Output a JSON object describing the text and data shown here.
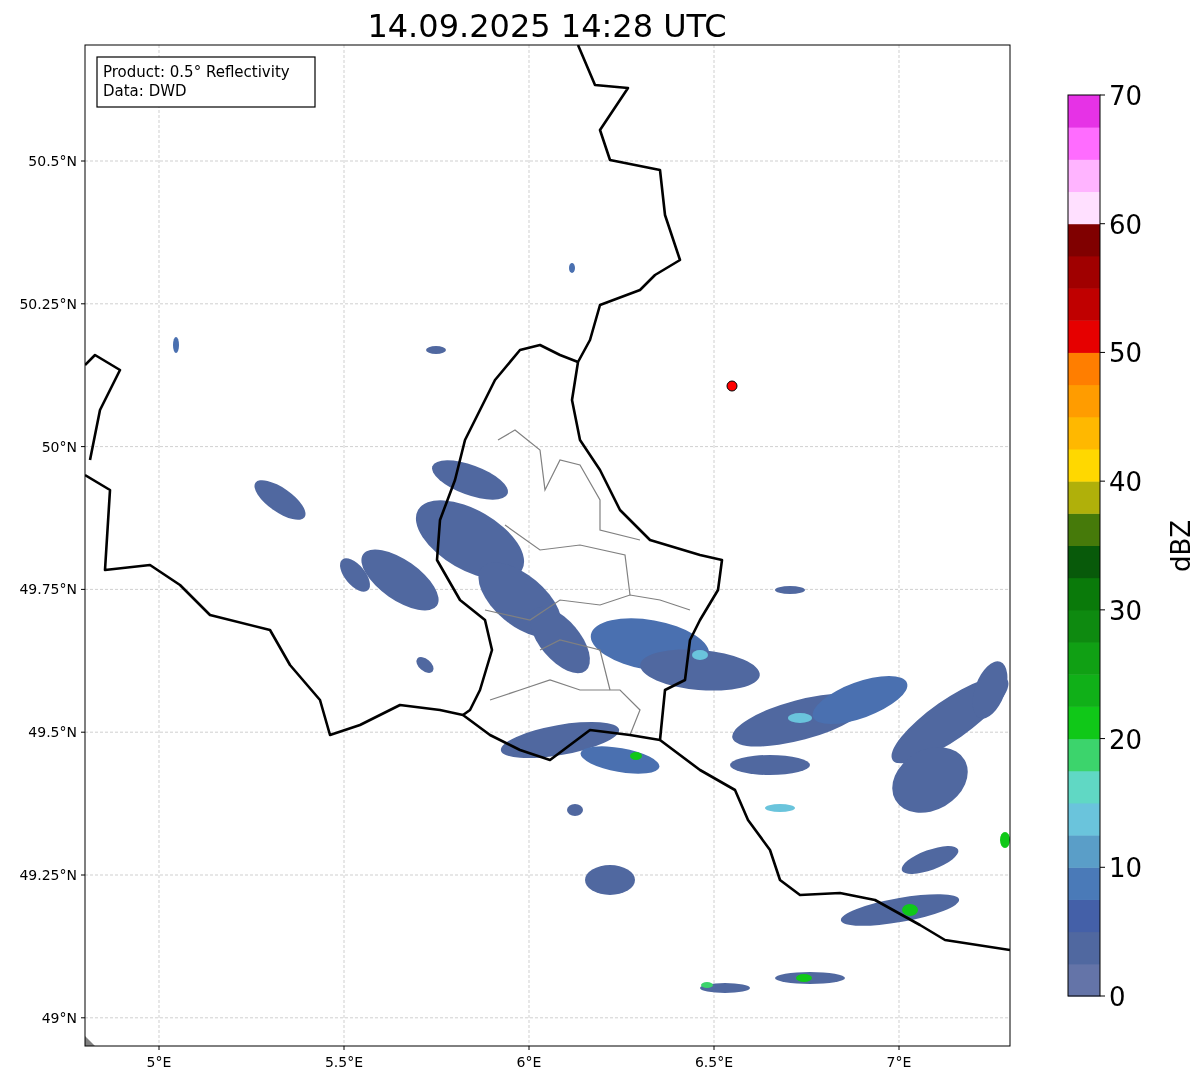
{
  "title": "14.09.2025 14:28 UTC",
  "info_box": [
    "Product: 0.5° Reflectivity",
    "Data: DWD"
  ],
  "y_ticks": [
    "50.5°N",
    "50.25°N",
    "50°N",
    "49.75°N",
    "49.5°N",
    "49.25°N",
    "49°N"
  ],
  "x_ticks": [
    "5°E",
    "5.5°E",
    "6°E",
    "6.5°E",
    "7°E"
  ],
  "colorbar": {
    "label": "dBZ",
    "ticks": [
      "70",
      "60",
      "50",
      "40",
      "30",
      "20",
      "10",
      "0"
    ],
    "bands": [
      {
        "color": "#6474a8"
      },
      {
        "color": "#5068a0"
      },
      {
        "color": "#4460a8"
      },
      {
        "color": "#4a7ab8"
      },
      {
        "color": "#5a9ec8"
      },
      {
        "color": "#6ac4dc"
      },
      {
        "color": "#60d8c4"
      },
      {
        "color": "#3cd46c"
      },
      {
        "color": "#10c818"
      },
      {
        "color": "#10b018"
      },
      {
        "color": "#10a014"
      },
      {
        "color": "#0e8a10"
      },
      {
        "color": "#0a7a0a"
      },
      {
        "color": "#085a0a"
      },
      {
        "color": "#467a0a"
      },
      {
        "color": "#b0b00a"
      },
      {
        "color": "#ffd800"
      },
      {
        "color": "#ffb800"
      },
      {
        "color": "#ff9c00"
      },
      {
        "color": "#ff7e00"
      },
      {
        "color": "#e60000"
      },
      {
        "color": "#c00000"
      },
      {
        "color": "#a00000"
      },
      {
        "color": "#800000"
      },
      {
        "color": "#ffe0ff"
      },
      {
        "color": "#ffb4ff"
      },
      {
        "color": "#ff6cff"
      },
      {
        "color": "#e632e6"
      }
    ]
  }
}
